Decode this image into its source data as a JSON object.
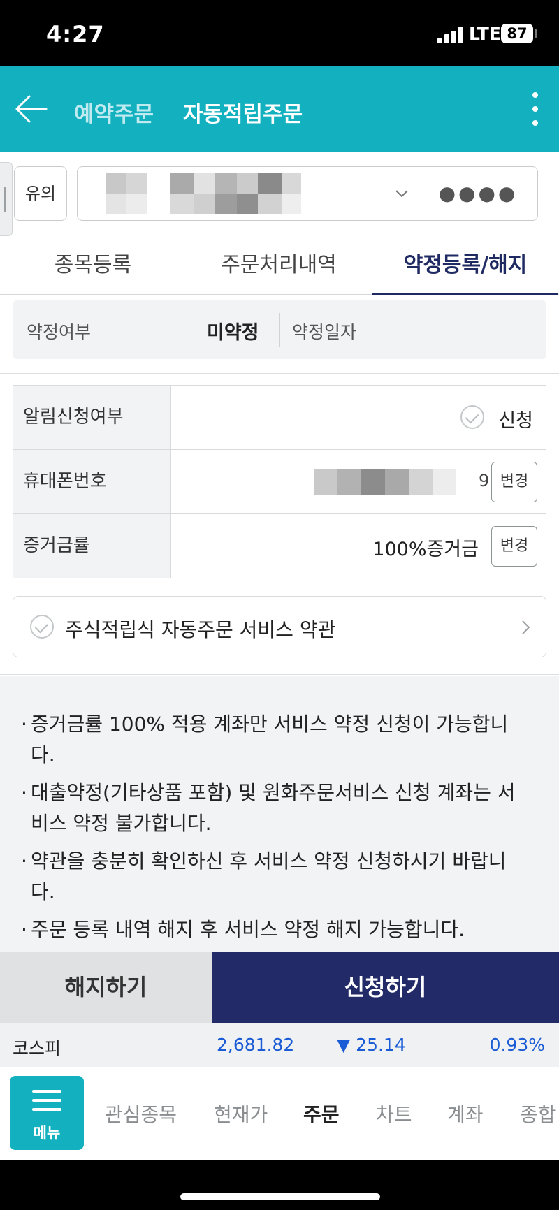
{
  "status_bar": {
    "time": "4:27",
    "network": "LTE",
    "battery": "87"
  },
  "header": {
    "tabs": [
      {
        "label": "예약주문",
        "active": false
      },
      {
        "label": "자동적립주문",
        "active": true
      }
    ],
    "accent_color": "#13b1bf"
  },
  "account_row": {
    "notice_label": "유의",
    "password_mask": "●●●●"
  },
  "sub_tabs": [
    {
      "label": "종목등록",
      "active": false
    },
    {
      "label": "주문처리내역",
      "active": false
    },
    {
      "label": "약정등록/해지",
      "active": true
    }
  ],
  "agreement": {
    "status_label": "약정여부",
    "status_value": "미약정",
    "date_label": "약정일자"
  },
  "form": {
    "rows": [
      {
        "label": "알림신청여부",
        "value": "신청"
      },
      {
        "label": "휴대폰번호",
        "value_tail": "9",
        "button": "변경"
      },
      {
        "label": "증거금률",
        "value": "100%증거금",
        "button": "변경"
      }
    ],
    "terms_label": "주식적립식 자동주문 서비스 약관"
  },
  "notes": [
    "증거금률 100% 적용 계좌만 서비스 약정 신청이 가능합니다.",
    "대출약정(기타상품 포함) 및 원화주문서비스 신청 계좌는 서비스 약정 불가합니다.",
    "약관을 충분히 확인하신 후 서비스 약정 신청하시기 바랍니다.",
    "주문 등록 내역 해지 후 서비스 약정 해지 가능합니다."
  ],
  "actions": {
    "cancel_label": "해지하기",
    "apply_label": "신청하기",
    "apply_color": "#222a68"
  },
  "ticker": {
    "name": "코스피",
    "price": "2,681.82",
    "change": "▼ 25.14",
    "rate": "0.93%",
    "color": "#1a5bd6"
  },
  "bottom_nav": {
    "menu_label": "메뉴",
    "items": [
      {
        "label": "관심종목",
        "active": false
      },
      {
        "label": "현재가",
        "active": false
      },
      {
        "label": "주문",
        "active": true
      },
      {
        "label": "차트",
        "active": false
      },
      {
        "label": "계좌",
        "active": false
      },
      {
        "label": "종합",
        "active": false
      }
    ]
  }
}
